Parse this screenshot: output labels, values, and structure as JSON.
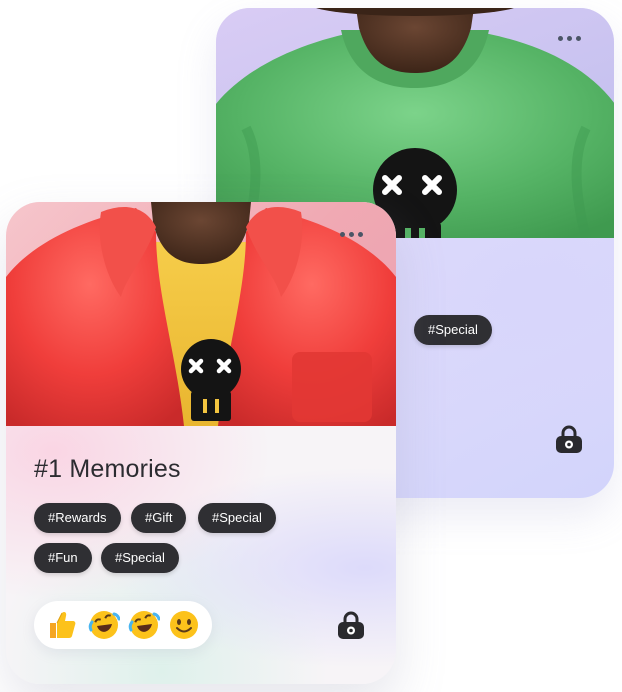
{
  "back_card": {
    "tags": [
      "#Special"
    ]
  },
  "front_card": {
    "title": "#1 Memories",
    "tags": [
      "#Rewards",
      "#Gift",
      "#Special",
      "#Fun",
      "#Special"
    ],
    "reactions": [
      "thumbs-up-emoji",
      "rolling-laughing-emoji",
      "rolling-laughing-emoji",
      "smiling-emoji"
    ]
  },
  "colors": {
    "back_shirt": "#55b365",
    "front_jacket": "#f03e3b",
    "front_shirt": "#f3c540",
    "tag_bg": "#2f2f33",
    "skin": "#5a3a2a",
    "lock": "#2a2a2e"
  }
}
